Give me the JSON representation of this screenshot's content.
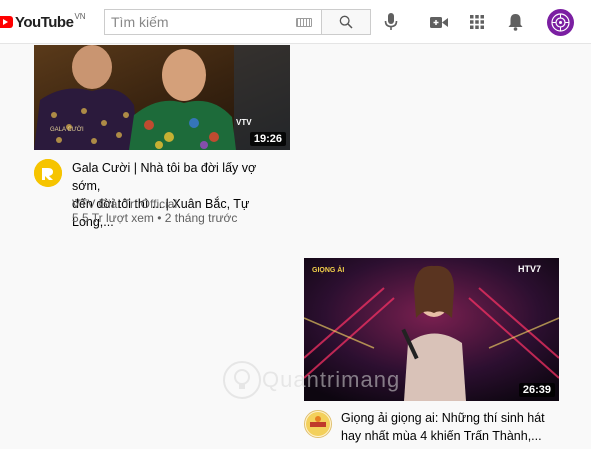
{
  "header": {
    "logo_text": "YouTube",
    "logo_country": "VN",
    "search_placeholder": "Tìm kiếm",
    "icons": [
      "keyboard-icon",
      "search-icon",
      "mic-icon",
      "video-camera-icon",
      "apps-grid-icon",
      "bell-icon",
      "avatar"
    ]
  },
  "videos": [
    {
      "title_line1": "Gala Cười | Nhà tôi ba đời lấy vợ sớm,",
      "title_line2": "đến đời tôi thì ... | Xuân Bắc, Tự Long,...",
      "channel": "VTV Giải Trí Official",
      "stats": "5,5 Tr lượt xem • 2 tháng trước",
      "duration": "19:26",
      "thumb_overlay": "VTV",
      "thumb_caption": "GALA CƯỜI"
    },
    {
      "title_line1": "Giọng ải giọng ai: Những thí sinh hát",
      "title_line2": "hay nhất mùa 4 khiến Trấn Thành,...",
      "duration": "26:39",
      "thumb_overlay": "HTV7"
    }
  ],
  "watermark": "Quantrimang",
  "colors": {
    "brand_red": "#ff0000",
    "avatar_purple": "#7b1fa2",
    "channel_yellow": "#f6c400"
  }
}
